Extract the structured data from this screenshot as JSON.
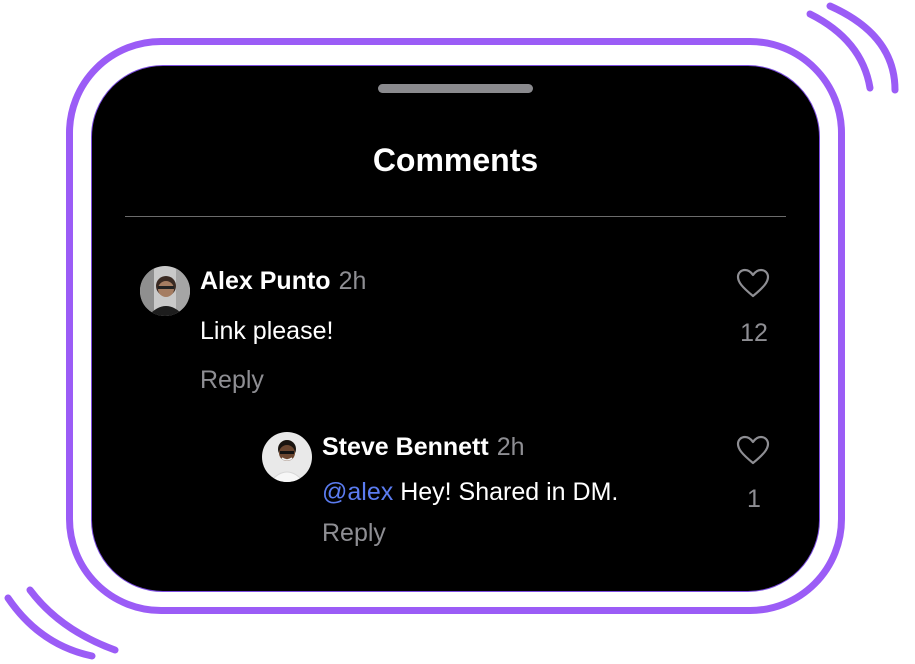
{
  "sheet": {
    "title": "Comments"
  },
  "comments": [
    {
      "author": "Alex Punto",
      "time": "2h",
      "text": "Link please!",
      "reply_label": "Reply",
      "likes": "12"
    },
    {
      "author": "Steve Bennett",
      "time": "2h",
      "mention": "@alex",
      "text": " Hey! Shared in DM.",
      "reply_label": "Reply",
      "likes": "1"
    }
  ],
  "icons": {
    "like": "heart-icon"
  },
  "colors": {
    "frame": "#9b5cf6",
    "background": "#000000",
    "mention": "#5b7cf0",
    "secondary_text": "#8e8e93"
  }
}
